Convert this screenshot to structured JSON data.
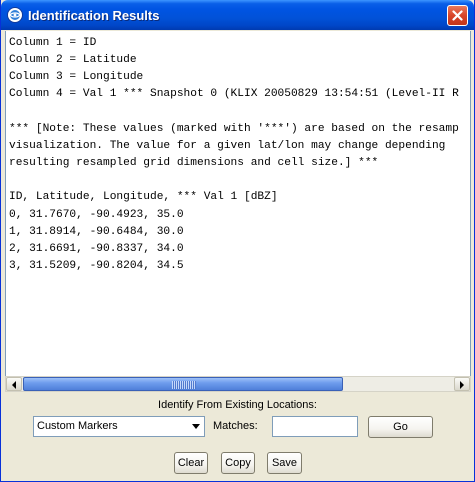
{
  "window": {
    "title": "Identification Results",
    "close_icon": "close-icon",
    "app_icon": "app-globe-icon"
  },
  "results": {
    "lines": [
      "Column 1 = ID",
      "Column 2 = Latitude",
      "Column 3 = Longitude",
      "Column 4 = Val 1 *** Snapshot 0 (KLIX 20050829 13:54:51 (Level-II R",
      "",
      "*** [Note: These values (marked with '***') are based on the resamp",
      "visualization. The value for a given lat/lon may change depending",
      "resulting resampled grid dimensions and cell size.] ***",
      "",
      "ID, Latitude, Longitude, *** Val 1 [dBZ]",
      "0, 31.7670, -90.4923, 35.0",
      "1, 31.8914, -90.6484, 30.0",
      "2, 31.6691, -90.8337, 34.0",
      "3, 31.5209, -90.8204, 34.5"
    ]
  },
  "scrollbar": {
    "position_fraction": 0.0,
    "visible_fraction": 0.74
  },
  "identify": {
    "label": "Identify From Existing Locations:",
    "dropdown_value": "Custom Markers",
    "matches_label": "Matches:",
    "matches_value": "",
    "go_label": "Go"
  },
  "actions": {
    "clear_label": "Clear",
    "copy_label": "Copy",
    "save_label": "Save"
  }
}
